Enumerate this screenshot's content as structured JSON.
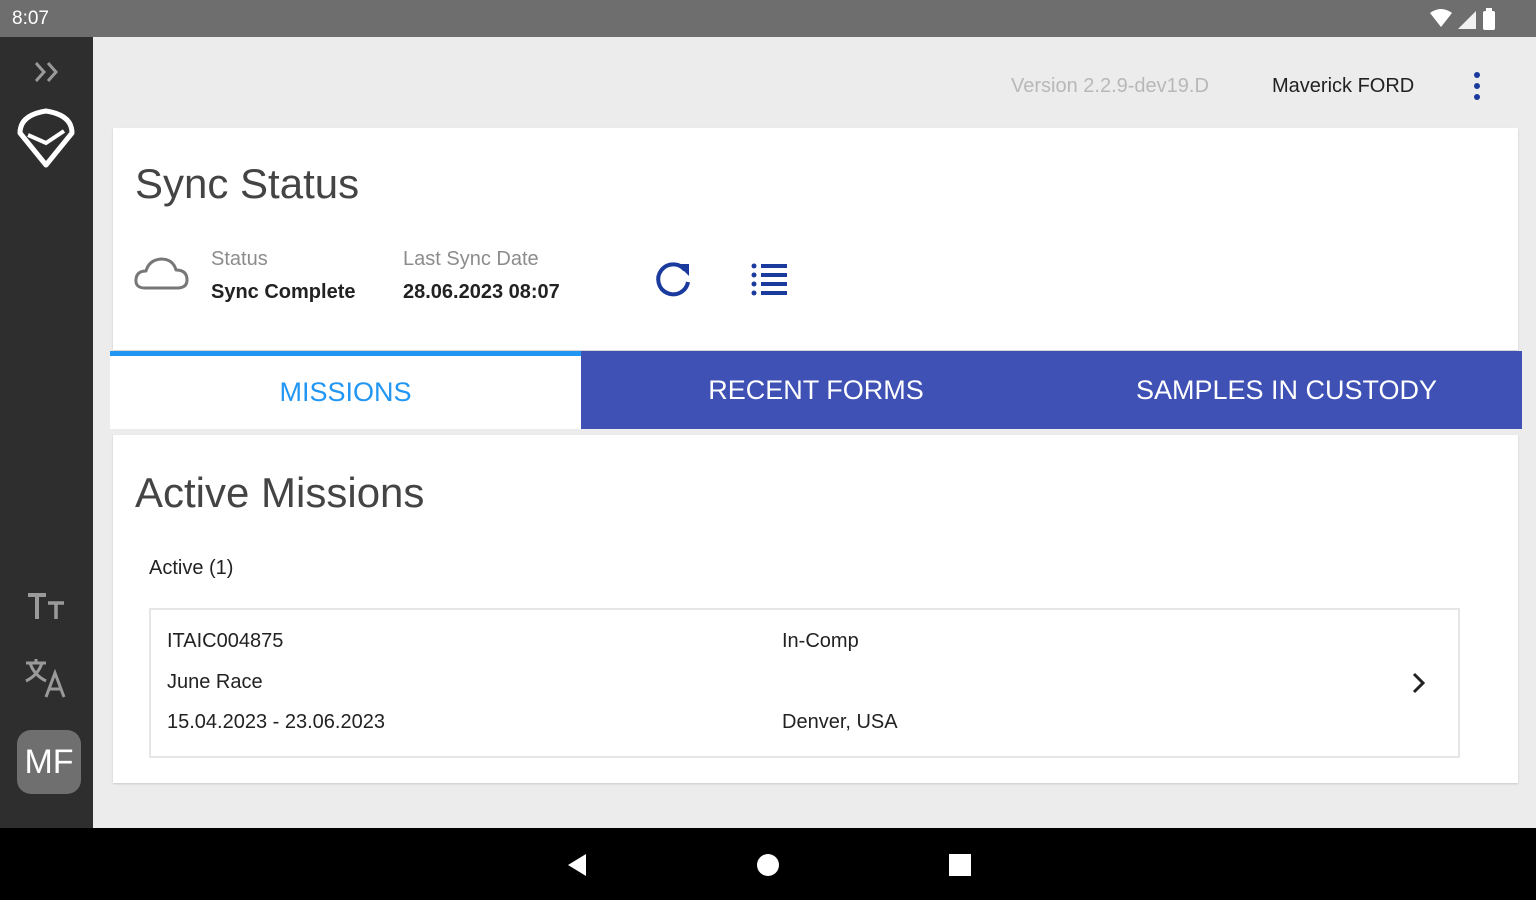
{
  "status_bar": {
    "time": "8:07"
  },
  "rail": {
    "avatar_initials": "MF"
  },
  "topbar": {
    "version": "Version 2.2.9-dev19.D",
    "user_name": "Maverick FORD"
  },
  "sync": {
    "title": "Sync Status",
    "status_label": "Status",
    "status_value": "Sync Complete",
    "last_sync_label": "Last Sync Date",
    "last_sync_value": "28.06.2023 08:07"
  },
  "tabs": [
    {
      "label": "MISSIONS",
      "active": true
    },
    {
      "label": "RECENT FORMS",
      "active": false
    },
    {
      "label": "SAMPLES IN CUSTODY",
      "active": false
    }
  ],
  "missions": {
    "heading": "Active Missions",
    "active_count_label": "Active (1)",
    "items": [
      {
        "id": "ITAIC004875",
        "name": "June Race",
        "dates": "15.04.2023  - 23.06.2023",
        "type": "In-Comp",
        "location": "Denver, USA"
      }
    ]
  },
  "colors": {
    "accent_blue": "#2196f3",
    "tab_bar": "#3f51b5",
    "icon_blue": "#1a3a9e",
    "rail_bg": "#2e2e2e"
  },
  "icons": {
    "expand": "double-chevron-right-icon",
    "logo": "shield-logo",
    "text_size": "text-size-icon",
    "translate": "translate-icon",
    "menu": "more-vertical-icon",
    "cloud": "cloud-icon",
    "refresh": "refresh-icon",
    "list": "list-icon",
    "chevron": "chevron-right-icon"
  }
}
